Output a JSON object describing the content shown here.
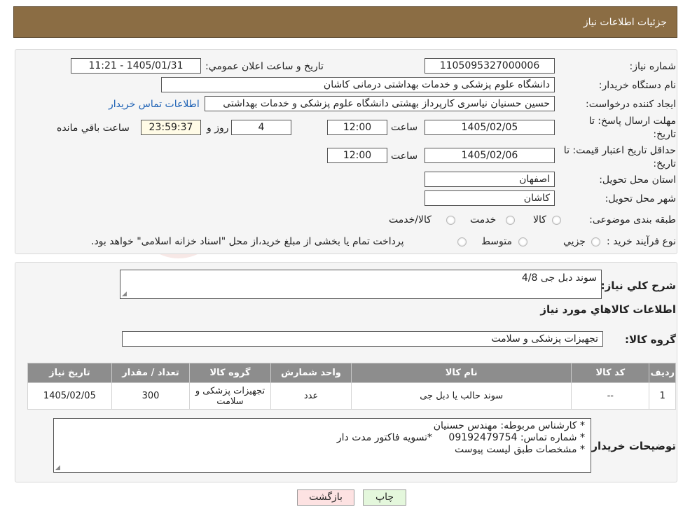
{
  "header": {
    "title": "جزئیات اطلاعات نیاز"
  },
  "form": {
    "need_number_label": "شماره نیاز:",
    "need_number": "1105095327000006",
    "announce_label": "تاریخ و ساعت اعلان عمومي:",
    "announce_value": "1405/01/31 - 11:21",
    "buyer_label": "نام دستگاه خریدار:",
    "buyer_value": "دانشگاه علوم پزشکی و خدمات بهداشتی درمانی کاشان",
    "creator_label": "ایجاد کننده درخواست:",
    "creator_value": "حسین حسنیان نیاسری کارپرداز بهشتی دانشگاه علوم پزشکی و خدمات بهداشتی",
    "contact_link": "اطلاعات تماس خریدار",
    "deadline_label_1": "مهلت ارسال پاسخ: تا",
    "deadline_label_2": "تاریخ:",
    "deadline_date": "1405/02/05",
    "hour_label": "ساعت",
    "deadline_time": "12:00",
    "days_value": "4",
    "days_label": "روز و",
    "remaining_time": "23:59:37",
    "remaining_label": "ساعت باقي مانده",
    "validity_label_1": "حداقل تاریخ اعتبار قیمت: تا",
    "validity_label_2": "تاریخ:",
    "validity_date": "1405/02/06",
    "validity_time": "12:00",
    "province_label": "استان محل تحویل:",
    "province_value": "اصفهان",
    "city_label": "شهر محل تحویل:",
    "city_value": "کاشان",
    "category_label": "طبقه بندی موضوعی:",
    "category_options": [
      "کالا",
      "خدمت",
      "کالا/خدمت"
    ],
    "process_label": "نوع فرآیند خرید :",
    "process_options": [
      "جزیي",
      "متوسط"
    ],
    "process_note": "پرداخت تمام یا بخشی از مبلغ خرید،از محل \"اسناد خزانه اسلامی\" خواهد بود."
  },
  "section2": {
    "summary_label": "شرح کلي نیاز:",
    "summary_value": "سوند دبل جی 4/8",
    "goods_info_title": "اطلاعات کالاهاي مورد نیاز",
    "goods_group_label": "گروه کالا:",
    "goods_group_value": "تجهیزات پزشکی و سلامت",
    "table": {
      "headers": [
        "ردیف",
        "کد کالا",
        "نام کالا",
        "واحد شمارش",
        "گروه کالا",
        "تعداد / مقدار",
        "تاریخ نیاز"
      ],
      "rows": [
        [
          "1",
          "--",
          "سوند حالب یا دبل جی",
          "عدد",
          "تجهیزات پزشکی و سلامت",
          "300",
          "1405/02/05"
        ]
      ]
    },
    "buyer_notes_label": "توضیحات خریدار:",
    "buyer_notes": {
      "line1": "*  کارشناس مربوطه: مهندس حسنیان",
      "line2": "*  شماره تماس: 09192479754",
      "line2b": "*تسویه فاکتور مدت دار",
      "line3": "*  مشخصات طبق لیست پیوست"
    }
  },
  "buttons": {
    "print": "چاپ",
    "back": "بازگشت"
  },
  "colors": {
    "header_bg": "#8b6d44",
    "table_header_bg": "#8d8d8d",
    "back_button_bg": "#fde2e2",
    "print_button_bg": "#e4f7dc"
  }
}
